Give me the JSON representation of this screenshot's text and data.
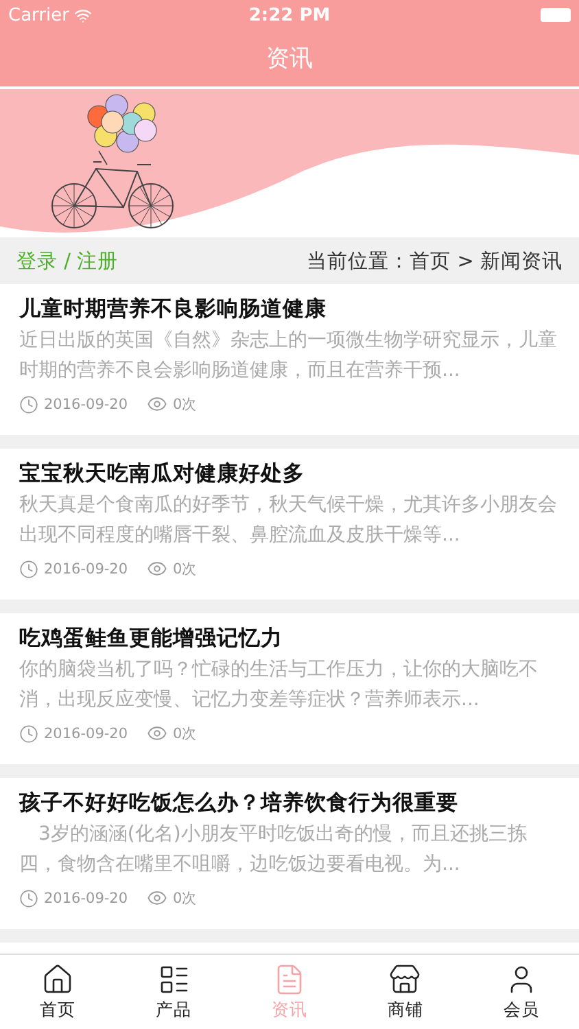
{
  "status_bar": {
    "carrier": "Carrier",
    "time": "2:22 PM"
  },
  "nav_bar": {
    "title": "资讯"
  },
  "breadcrumb_bar": {
    "login": "登录 / 注册",
    "location": "当前位置：首页 > 新闻资讯"
  },
  "articles": [
    {
      "title": "儿童时期营养不良影响肠道健康",
      "summary": "近日出版的英国《自然》杂志上的一项微生物学研究显示，儿童时期的营养不良会影响肠道健康，而且在营养干预...",
      "date": "2016-09-20",
      "views": "0次"
    },
    {
      "title": "宝宝秋天吃南瓜对健康好处多",
      "summary": "秋天真是个食南瓜的好季节，秋天气候干燥，尤其许多小朋友会出现不同程度的嘴唇干裂、鼻腔流血及皮肤干燥等...",
      "date": "2016-09-20",
      "views": "0次"
    },
    {
      "title": "吃鸡蛋鲑鱼更能增强记忆力",
      "summary": "你的脑袋当机了吗？忙碌的生活与工作压力，让你的大脑吃不消，出现反应变慢、记忆力变差等症状？营养师表示...",
      "date": "2016-09-20",
      "views": "0次"
    },
    {
      "title": "孩子不好好吃饭怎么办？培养饮食行为很重要",
      "summary": "　3岁的涵涵(化名)小朋友平时吃饭出奇的慢，而且还挑三拣四，食物含在嘴里不咀嚼，边吃饭边要看电视。为...",
      "date": "2016-09-20",
      "views": "0次"
    }
  ],
  "tab_bar": [
    {
      "kind": "home",
      "label": "首页",
      "selected": false
    },
    {
      "kind": "products",
      "label": "产品",
      "selected": false
    },
    {
      "kind": "news",
      "label": "资讯",
      "selected": true
    },
    {
      "kind": "shop",
      "label": "商铺",
      "selected": false
    },
    {
      "kind": "member",
      "label": "会员",
      "selected": false
    }
  ]
}
